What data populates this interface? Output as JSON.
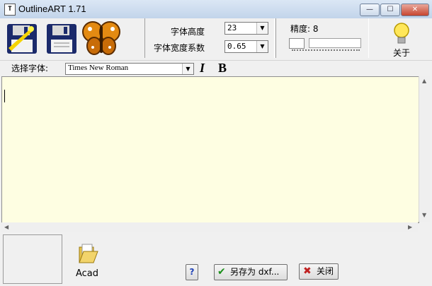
{
  "window": {
    "title": "OutlineART 1.71",
    "app_icon_glyph": "T"
  },
  "titlebar": {
    "minimize": "—",
    "maximize": "☐",
    "close": "✕"
  },
  "toolbar": {
    "height_label": "字体高度",
    "height_value": "23",
    "width_label": "字体宽度系数",
    "width_value": "0.65",
    "precision_label": "精度: 8",
    "about_label": "关于"
  },
  "fontrow": {
    "select_label": "选择字体:",
    "font_value": "Times New Roman",
    "italic": "I",
    "bold": "B"
  },
  "bottom": {
    "acad_label": "Acad",
    "help_glyph": "?",
    "saveas_label": "另存为 dxf...",
    "close_label": "关闭"
  },
  "colors": {
    "editor_bg": "#fefee2",
    "check_green": "#1a8f1a",
    "close_x_red": "#c02020"
  }
}
